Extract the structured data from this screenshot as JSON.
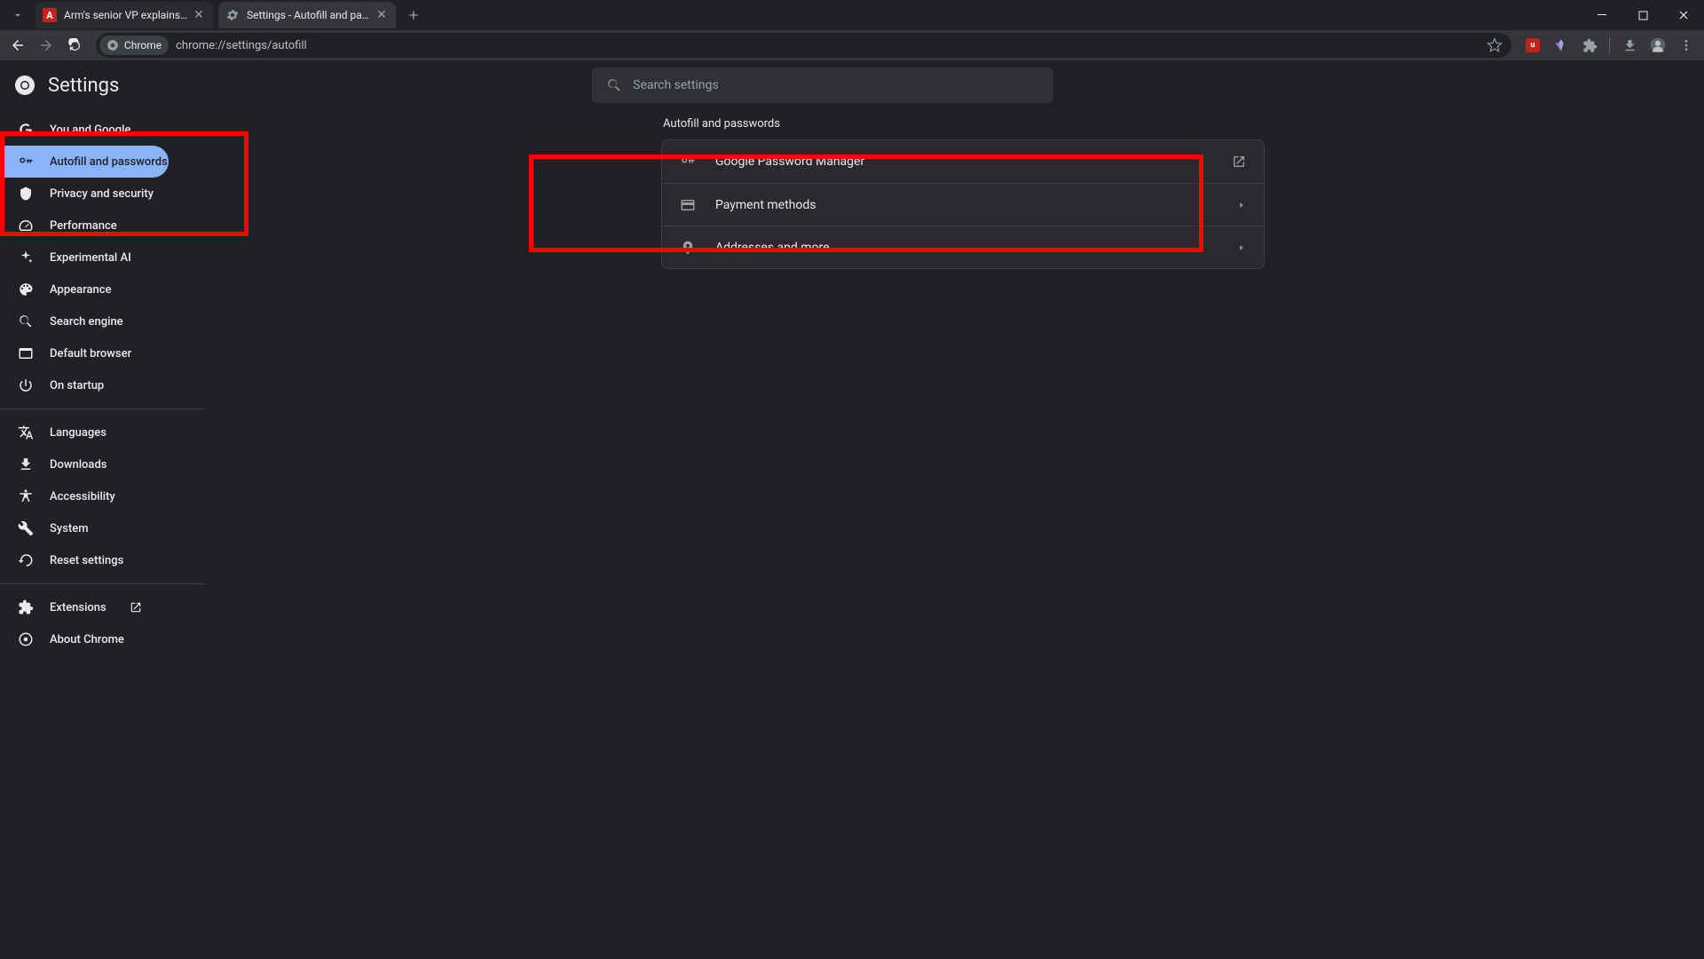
{
  "window": {
    "tabs": [
      {
        "title": "Arm's senior VP explains AI's tr",
        "favicon_bg": "#c5221f",
        "favicon_text": "A"
      },
      {
        "title": "Settings - Autofill and passwor"
      }
    ],
    "minimize": "—",
    "maximize": "□",
    "close": "✕"
  },
  "toolbar": {
    "chip_label": "Chrome",
    "url": "chrome://settings/autofill"
  },
  "header": {
    "title": "Settings",
    "search_placeholder": "Search settings"
  },
  "sidebar": {
    "group1": [
      {
        "label": "You and Google"
      },
      {
        "label": "Autofill and passwords",
        "selected": true
      },
      {
        "label": "Privacy and security"
      },
      {
        "label": "Performance"
      },
      {
        "label": "Experimental AI"
      },
      {
        "label": "Appearance"
      },
      {
        "label": "Search engine"
      },
      {
        "label": "Default browser"
      },
      {
        "label": "On startup"
      }
    ],
    "group2": [
      {
        "label": "Languages"
      },
      {
        "label": "Downloads"
      },
      {
        "label": "Accessibility"
      },
      {
        "label": "System"
      },
      {
        "label": "Reset settings"
      }
    ],
    "group3": [
      {
        "label": "Extensions",
        "external": true
      },
      {
        "label": "About Chrome"
      }
    ]
  },
  "main": {
    "section_title": "Autofill and passwords",
    "rows": [
      {
        "label": "Google Password Manager",
        "action": "external"
      },
      {
        "label": "Payment methods",
        "action": "chevron"
      },
      {
        "label": "Addresses and more",
        "action": "chevron"
      }
    ]
  }
}
